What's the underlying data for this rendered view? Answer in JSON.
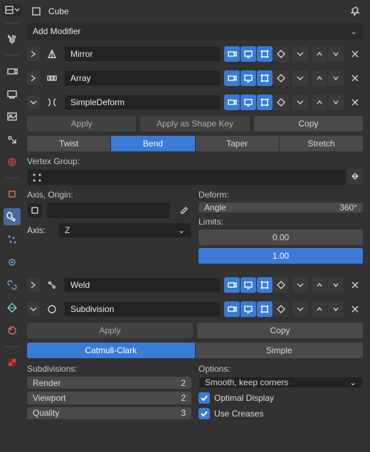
{
  "header": {
    "object": "Cube"
  },
  "add_modifier": "Add Modifier",
  "modifiers": [
    {
      "name": "Mirror"
    },
    {
      "name": "Array"
    },
    {
      "name": "SimpleDeform"
    },
    {
      "name": "Weld"
    },
    {
      "name": "Subdivision"
    }
  ],
  "simple_deform": {
    "apply": "Apply",
    "apply_shape": "Apply as Shape Key",
    "copy": "Copy",
    "modes": [
      "Twist",
      "Bend",
      "Taper",
      "Stretch"
    ],
    "vgroup_label": "Vertex Group:",
    "axis_origin_label": "Axis, Origin:",
    "axis_label": "Axis:",
    "axis_value": "Z",
    "deform_label": "Deform:",
    "angle_label": "Angle",
    "angle_value": "360°",
    "limits_label": "Limits:",
    "limit_lo": "0.00",
    "limit_hi": "1.00"
  },
  "subdivision": {
    "apply": "Apply",
    "copy": "Copy",
    "types": [
      "Catmull-Clark",
      "Simple"
    ],
    "subdiv_label": "Subdivisions:",
    "render_label": "Render",
    "render_value": "2",
    "viewport_label": "Viewport",
    "viewport_value": "2",
    "quality_label": "Quality",
    "quality_value": "3",
    "options_label": "Options:",
    "uv_smooth": "Smooth, keep corners",
    "optimal": "Optimal Display",
    "creases": "Use Creases"
  }
}
